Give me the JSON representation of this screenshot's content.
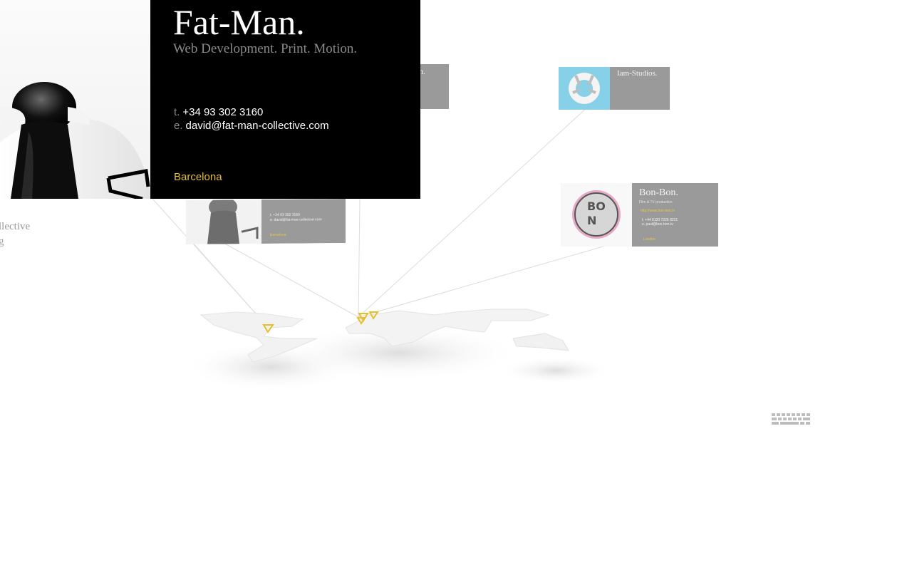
{
  "brand": {
    "name": "Fat-Man.",
    "tagline": "Web Development. Print. Motion."
  },
  "contact": {
    "phone_prefix": "t.",
    "phone": "+34 93 302 3160",
    "email_prefix": "e.",
    "email": "david@fat-man-collective.com",
    "city": "Barcelona"
  },
  "side_text": {
    "line1": "llective",
    "line2": "g"
  },
  "cards": {
    "fatman_small": {
      "phone": "t. +34 93 302 3160",
      "email": "e. david@fat-man-collective.com",
      "city": "Barcelona"
    },
    "partial_top": {
      "title": "n."
    },
    "iam_studios": {
      "title": "Iam-Studios."
    },
    "bon_bon": {
      "title": "Bon-Bon.",
      "subtitle": "Film & TV production",
      "link": "http://www.bon-bon.tv",
      "phone": "t. +44 0120 7226 8221",
      "email": "e. paul@bon-bon.tv",
      "city": "London"
    }
  },
  "colors": {
    "accent_yellow": "#e7bf2c",
    "card_black": "#000000",
    "card_grey": "#9a9a9a",
    "iam_blue": "#86d0e8"
  },
  "icons": {
    "keyboard": "keyboard-icon",
    "location_pin": "location-pin-icon"
  }
}
